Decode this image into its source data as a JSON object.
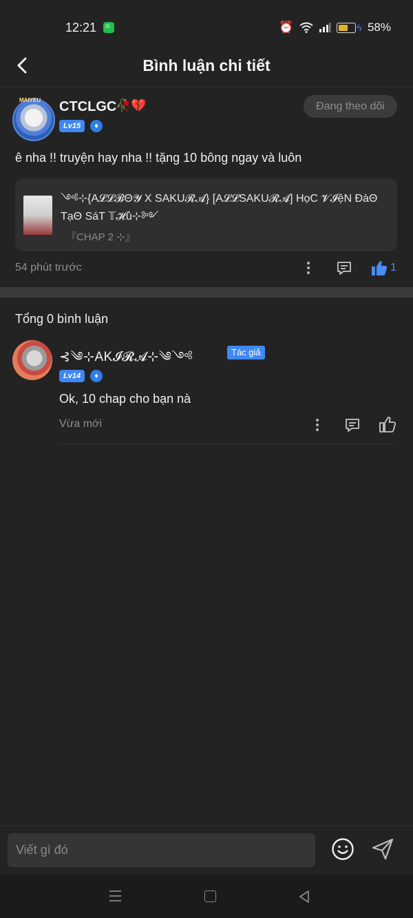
{
  "status_bar": {
    "time": "12:21",
    "battery": "58%",
    "battery_level": 0.58
  },
  "header": {
    "title": "Bình luận chi tiết"
  },
  "comment": {
    "username": "CTCLGC",
    "username_emoji": "🥀💔",
    "avatar_tag": "MAIYEU",
    "level": "Lv15",
    "follow_label": "Đang theo dõi",
    "text": "ê nha !! truyện hay nha !! tặng 10 bông ngay và luôn",
    "story_title": "༺⊹{A𝓛𝓛𝓑Θ𝓨 X SAKU𝓡𝓐} [A𝓛𝓛SAKU𝓡𝓐] HọC 𝓥𝓘ệN ĐàΘ TạΘ SáT 𝕋𝓗ủ⊹༻",
    "story_chap": "『CHAP 2 ⊹』",
    "time": "54 phút trước",
    "like_count": "1"
  },
  "total_label": "Tổng 0 bình luận",
  "reply": {
    "username": "⊰༄⊹AK𝓘𝓡𝓐⊹༄༺",
    "author_badge": "Tác giả",
    "level": "Lv14",
    "text": "Ok, 10 chap cho bạn nà",
    "time": "Vừa mới"
  },
  "input": {
    "placeholder": "Viết gì đó"
  }
}
